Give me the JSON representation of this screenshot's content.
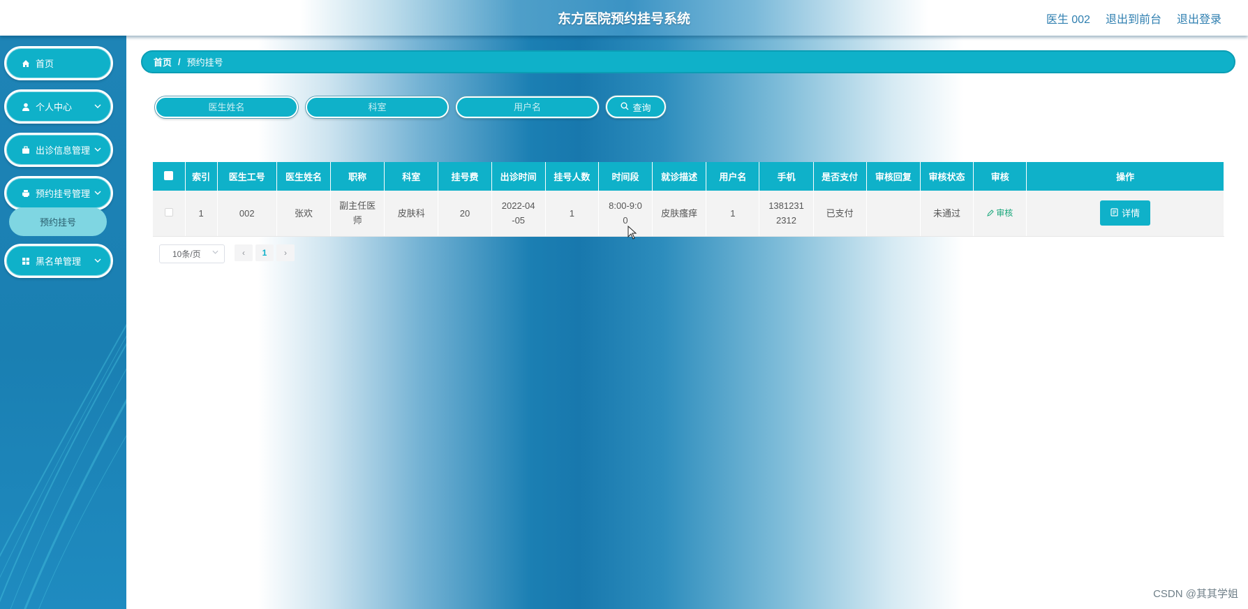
{
  "header": {
    "title": "东方医院预约挂号系统",
    "user": "医生 002",
    "back_to_front": "退出到前台",
    "logout": "退出登录"
  },
  "sidebar": {
    "items": [
      {
        "label": "首页",
        "icon": "home-icon"
      },
      {
        "label": "个人中心",
        "icon": "user-icon"
      },
      {
        "label": "出诊信息管理",
        "icon": "briefcase-icon"
      },
      {
        "label": "预约挂号管理",
        "icon": "printer-icon"
      },
      {
        "label": "黑名单管理",
        "icon": "grid-icon"
      }
    ],
    "sub_item": "预约挂号"
  },
  "breadcrumb": {
    "home": "首页",
    "sep": "/",
    "current": "预约挂号"
  },
  "search": {
    "doctor_name_placeholder": "医生姓名",
    "department_placeholder": "科室",
    "username_placeholder": "用户名",
    "query_label": "查询"
  },
  "table": {
    "headers": [
      "索引",
      "医生工号",
      "医生姓名",
      "职称",
      "科室",
      "挂号费",
      "出诊时间",
      "挂号人数",
      "时间段",
      "就诊描述",
      "用户名",
      "手机",
      "是否支付",
      "审核回复",
      "审核状态",
      "审核",
      "操作"
    ],
    "rows": [
      {
        "index": "1",
        "doctor_id": "002",
        "doctor_name": "张欢",
        "title_l1": "副主任医",
        "title_l2": "师",
        "department": "皮肤科",
        "fee": "20",
        "visit_date_l1": "2022-04",
        "visit_date_l2": "-05",
        "count": "1",
        "time_slot_l1": "8:00-9:0",
        "time_slot_l2": "0",
        "description": "皮肤瘙痒",
        "username": "1",
        "phone_l1": "1381231",
        "phone_l2": "2312",
        "paid": "已支付",
        "reply": "",
        "status": "未通过",
        "review_label": "审核",
        "detail_label": "详情"
      }
    ]
  },
  "pagination": {
    "page_size": "10条/页",
    "prev": "‹",
    "current_page": "1",
    "next": "›"
  },
  "watermark": "CSDN @其其学姐",
  "colors": {
    "accent": "#0fb1c9",
    "sidebar": "#1a7fb2",
    "review_link": "#17a67a"
  }
}
